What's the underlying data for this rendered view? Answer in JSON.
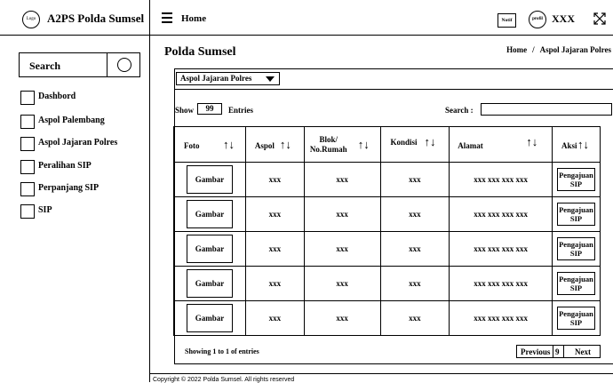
{
  "brand": {
    "logo_text": "Logo",
    "title": "A2PS Polda Sumsel"
  },
  "sidebar": {
    "search_label": "Search",
    "items": [
      {
        "label": "Dashbord"
      },
      {
        "label": "Aspol Palembang"
      },
      {
        "label": "Aspol Jajaran Polres"
      },
      {
        "label": "Peralihan SIP"
      },
      {
        "label": "Perpanjang SIP"
      },
      {
        "label": "SIP"
      }
    ]
  },
  "topbar": {
    "title": "Home",
    "notif_label": "Notif",
    "profil_label": "profil",
    "user_name": "XXX"
  },
  "page": {
    "title": "Polda Sumsel",
    "breadcrumb": [
      "Home",
      "Aspol Jajaran Polres"
    ],
    "breadcrumb_sep": "/"
  },
  "filter": {
    "selected": "Aspol Jajaran Polres"
  },
  "table_controls": {
    "show_label": "Show",
    "entries_value": "99",
    "entries_label": "Entries",
    "search_label": "Search :"
  },
  "table": {
    "columns": [
      "Foto",
      "Aspol",
      "Blok/ No.Rumah",
      "Kondisi",
      "Alamat",
      "Aksi"
    ],
    "rows": [
      {
        "foto": "Gambar",
        "aspol": "xxx",
        "blok": "xxx",
        "kondisi": "xxx",
        "alamat": "xxx xxx xxx xxx",
        "aksi": "Pengajuan SIP"
      },
      {
        "foto": "Gambar",
        "aspol": "xxx",
        "blok": "xxx",
        "kondisi": "xxx",
        "alamat": "xxx xxx xxx xxx",
        "aksi": "Pengajuan SIP"
      },
      {
        "foto": "Gambar",
        "aspol": "xxx",
        "blok": "xxx",
        "kondisi": "xxx",
        "alamat": "xxx xxx xxx xxx",
        "aksi": "Pengajuan SIP"
      },
      {
        "foto": "Gambar",
        "aspol": "xxx",
        "blok": "xxx",
        "kondisi": "xxx",
        "alamat": "xxx xxx xxx xxx",
        "aksi": "Pengajuan SIP"
      },
      {
        "foto": "Gambar",
        "aspol": "xxx",
        "blok": "xxx",
        "kondisi": "xxx",
        "alamat": "xxx xxx xxx xxx",
        "aksi": "Pengajuan SIP"
      }
    ]
  },
  "pagination": {
    "info": "Showing 1 to 1 of entries",
    "previous": "Previous",
    "current": "9",
    "next": "Next"
  },
  "footer": {
    "copyright": "Copyright © 2022 Polda Sumsel. All rights reserved"
  },
  "icons": {
    "menu": "hamburger-icon",
    "search": "circle-search-icon",
    "expand": "expand-arrows-icon",
    "dropdown": "triangle-down-icon",
    "sort": "sort-arrows-icon"
  }
}
